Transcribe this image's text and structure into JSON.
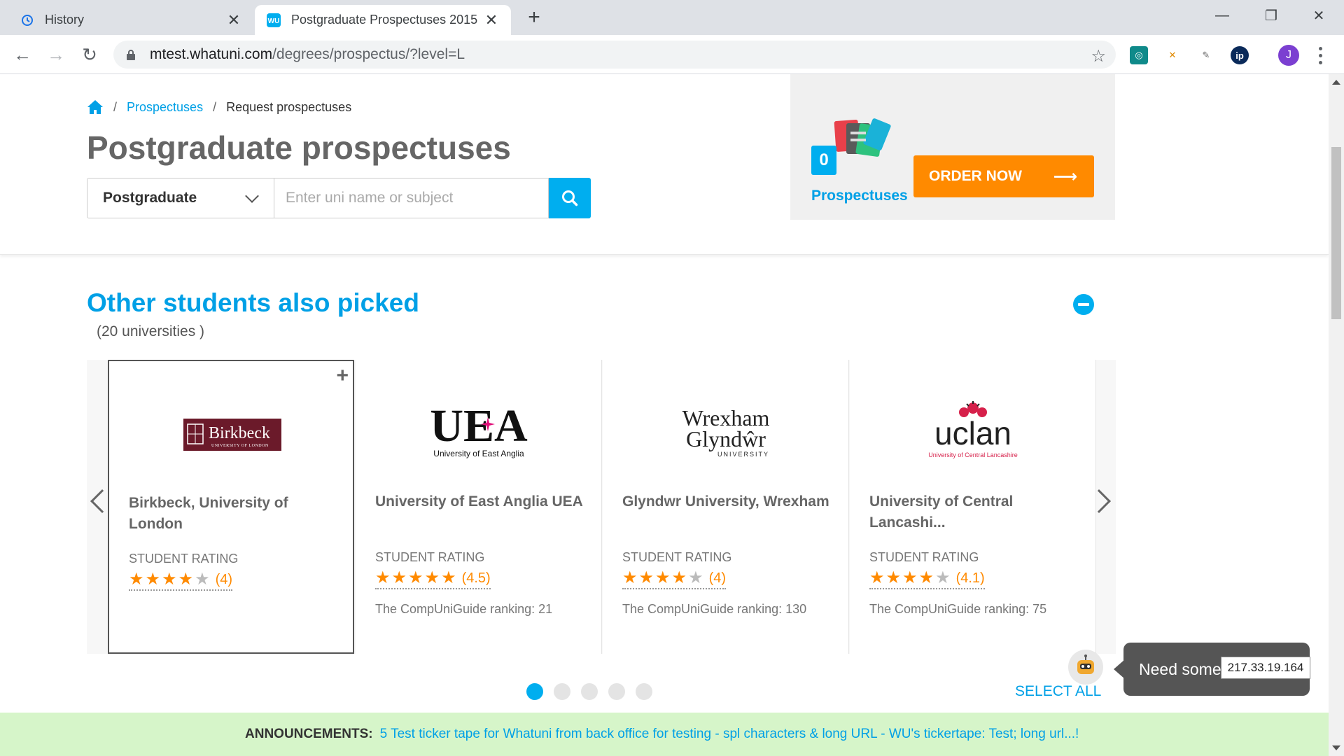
{
  "browser": {
    "tabs": [
      {
        "label": "History",
        "icon": "history-icon"
      },
      {
        "label": "Postgraduate Prospectuses 2015",
        "icon": "whatuni-favicon"
      }
    ],
    "url_host": "mtest.whatuni.com",
    "url_path": "/degrees/prospectus/?level=L",
    "avatar_letter": "J"
  },
  "breadcrumb": {
    "link": "Prospectuses",
    "current": "Request prospectuses",
    "separator": "/"
  },
  "page_title": "Postgraduate prospectuses",
  "search": {
    "level_value": "Postgraduate",
    "placeholder": "Enter uni name or subject"
  },
  "basket": {
    "count": "0",
    "label": "Prospectuses",
    "order_label": "ORDER NOW",
    "arrow": "⟶"
  },
  "section": {
    "title": "Other students also picked",
    "subtitle": "(20 universities )"
  },
  "cards": [
    {
      "name": "Birkbeck, University of London",
      "rating_label": "STUDENT RATING",
      "rating": 4,
      "rating_text": "(4)",
      "ranking": ""
    },
    {
      "name": "University of East Anglia UEA",
      "rating_label": "STUDENT RATING",
      "rating": 4.5,
      "rating_text": "(4.5)",
      "ranking": "The CompUniGuide ranking: 21"
    },
    {
      "name": "Glyndwr University, Wrexham",
      "rating_label": "STUDENT RATING",
      "rating": 4,
      "rating_text": "(4)",
      "ranking": "The CompUniGuide ranking: 130"
    },
    {
      "name": "University of Central Lancashi...",
      "rating_label": "STUDENT RATING",
      "rating": 4.1,
      "rating_text": "(4.1)",
      "ranking": "The CompUniGuide ranking: 75"
    }
  ],
  "logos": {
    "birkbeck": {
      "main": "Birkbeck",
      "sub": "UNIVERSITY OF LONDON"
    },
    "uea": {
      "main": "UEA",
      "sub": "University of East Anglia"
    },
    "wrexham": {
      "line1": "Wrexham",
      "line2": "Glyndŵr",
      "sub": "UNIVERSITY"
    },
    "uclan": {
      "main": "uclan",
      "sub": "University of Central Lancashire"
    }
  },
  "pagination": {
    "count": 5,
    "active": 1
  },
  "select_all": "SELECT ALL",
  "help": {
    "text": "Need some help?"
  },
  "ticker": {
    "label": "ANNOUNCEMENTS:",
    "text": "5 Test ticker tape for Whatuni from back office for testing - spl characters & long URL - WU's tickertape: Test; long url...!"
  },
  "ip": "217.33.19.164",
  "colors": {
    "accent": "#00aeef",
    "order": "#ff8a00",
    "star_on": "#ff8a00",
    "star_off": "#bbbbbb",
    "ticker_bg": "#d6f5c9"
  }
}
